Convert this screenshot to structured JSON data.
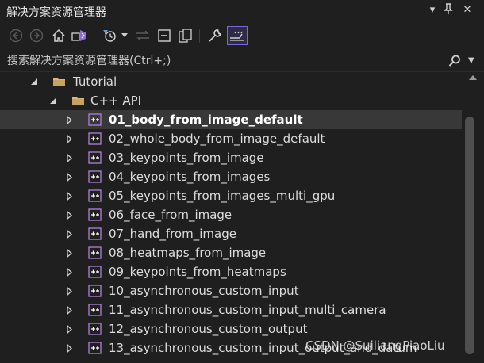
{
  "panel": {
    "title": "解决方案资源管理器"
  },
  "search": {
    "placeholder": "搜索解决方案资源管理器(Ctrl+;)"
  },
  "tree": {
    "root": {
      "label": "Tutorial",
      "icon": "folder-icon"
    },
    "folder": {
      "label": "C++ API",
      "icon": "folder-icon"
    },
    "items": [
      {
        "label": "01_body_from_image_default",
        "selected": true
      },
      {
        "label": "02_whole_body_from_image_default"
      },
      {
        "label": "03_keypoints_from_image"
      },
      {
        "label": "04_keypoints_from_images"
      },
      {
        "label": "05_keypoints_from_images_multi_gpu"
      },
      {
        "label": "06_face_from_image"
      },
      {
        "label": "07_hand_from_image"
      },
      {
        "label": "08_heatmaps_from_image"
      },
      {
        "label": "09_keypoints_from_heatmaps"
      },
      {
        "label": "10_asynchronous_custom_input"
      },
      {
        "label": "11_asynchronous_custom_input_multi_camera"
      },
      {
        "label": "12_asynchronous_custom_output"
      },
      {
        "label": "13_asynchronous_custom_input_output_and_datum"
      }
    ]
  },
  "watermark": "CSDN @SuiliangPiaoLiu",
  "colors": {
    "background": "#1f1f1f",
    "selected_row": "#383838",
    "folder": "#dcb67a",
    "project_icon": "#b180d7",
    "active_toggle": "#7a68d8"
  }
}
